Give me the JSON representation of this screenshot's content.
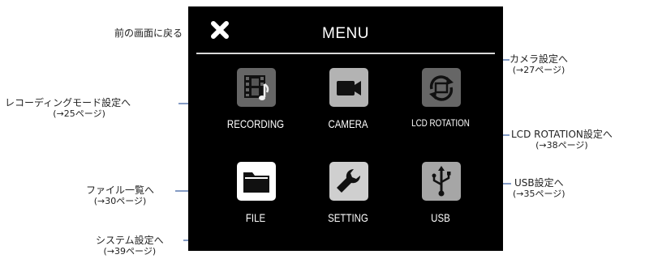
{
  "screen": {
    "title": "MENU",
    "close_icon": "close-icon",
    "tiles": [
      {
        "label": "RECORDING",
        "icon": "film-music-icon",
        "color": "#666666"
      },
      {
        "label": "CAMERA",
        "icon": "video-camera-icon",
        "color": "#b3b3b3"
      },
      {
        "label": "LCD ROTATION",
        "icon": "rotation-icon",
        "color": "#666666"
      },
      {
        "label": "FILE",
        "icon": "folder-icon",
        "color": "#ffffff"
      },
      {
        "label": "SETTING",
        "icon": "wrench-icon",
        "color": "#cfcfcf"
      },
      {
        "label": "USB",
        "icon": "usb-icon",
        "color": "#a6a6a6"
      }
    ]
  },
  "annotations": {
    "back": {
      "main": "前の画面に戻る"
    },
    "recording": {
      "main": "レコーディングモード設定へ",
      "sub": "(→25ページ)"
    },
    "camera": {
      "main": "カメラ設定へ",
      "sub": "(→27ページ)"
    },
    "lcd": {
      "main": "LCD ROTATION設定へ",
      "sub": "(→38ページ)"
    },
    "file": {
      "main": "ファイル一覧へ",
      "sub": "(→30ページ)"
    },
    "usb": {
      "main": "USB設定へ",
      "sub": "(→35ページ)"
    },
    "system": {
      "main": "システム設定へ",
      "sub": "(→39ページ)"
    }
  },
  "colors": {
    "screen_bg": "#000000",
    "annotation_line": "#3a5fa0"
  }
}
